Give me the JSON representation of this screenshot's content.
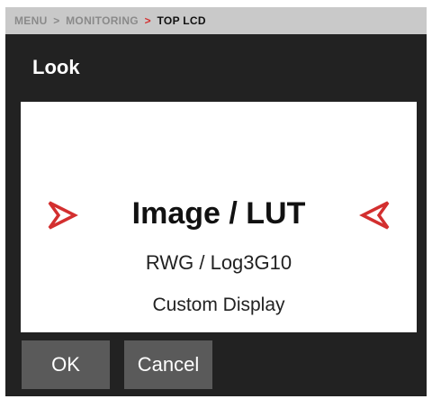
{
  "breadcrumb": {
    "items": [
      "MENU",
      "MONITORING"
    ],
    "current": "TOP LCD"
  },
  "dialog": {
    "title": "Look",
    "selector": {
      "value": "Image / LUT",
      "prev_icon": "chevron-left-icon",
      "next_icon": "chevron-right-icon"
    },
    "lut": "RWG / Log3G10",
    "display": "Custom Display"
  },
  "buttons": {
    "ok_label": "OK",
    "cancel_label": "Cancel"
  },
  "colors": {
    "accent": "#d32f2f",
    "background": "#222222",
    "panel": "#ffffff",
    "button": "#5a5a5a",
    "breadcrumb_bar": "#c9c9c9"
  }
}
